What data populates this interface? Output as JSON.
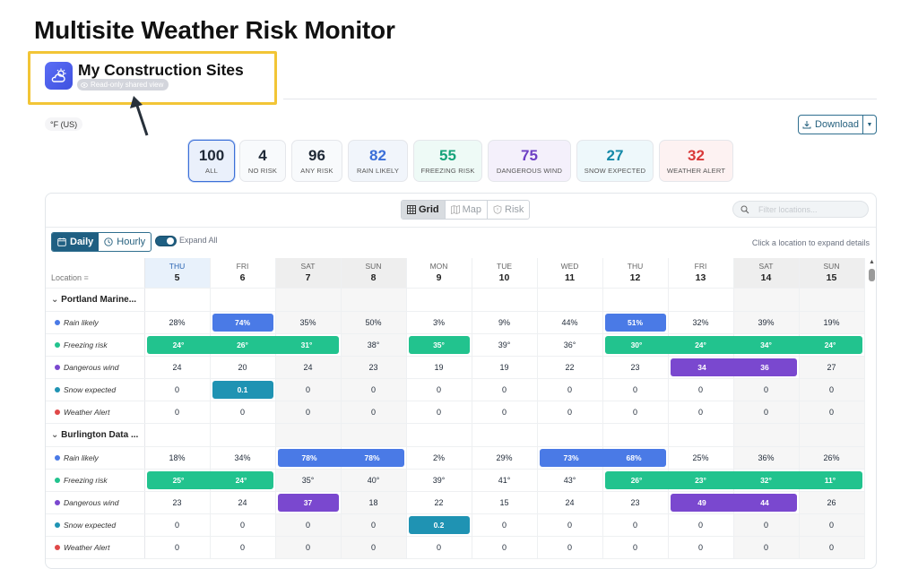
{
  "page_title": "Multisite Weather Risk Monitor",
  "header": {
    "site_title": "My Construction Sites",
    "readonly_label": "Read-only shared view",
    "app_icon": "cloud-sun-icon"
  },
  "unit_label": "°F (US)",
  "download_label": "Download",
  "summary_cards": [
    {
      "value": "100",
      "label": "ALL",
      "color": "#1f2937",
      "selected": true
    },
    {
      "value": "4",
      "label": "NO RISK",
      "color": "#1f2937"
    },
    {
      "value": "96",
      "label": "ANY RISK",
      "color": "#1f2937"
    },
    {
      "value": "82",
      "label": "RAIN LIKELY",
      "color": "#3b6fd8"
    },
    {
      "value": "55",
      "label": "FREEZING RISK",
      "color": "#16a37a"
    },
    {
      "value": "75",
      "label": "DANGEROUS WIND",
      "color": "#6d3fc4"
    },
    {
      "value": "27",
      "label": "SNOW EXPECTED",
      "color": "#1489a8"
    },
    {
      "value": "32",
      "label": "WEATHER ALERT",
      "color": "#d93a3a"
    }
  ],
  "view_tabs": {
    "grid": "Grid",
    "map": "Map",
    "risk": "Risk"
  },
  "filter_placeholder": "Filter locations...",
  "modes": {
    "daily": "Daily",
    "hourly": "Hourly"
  },
  "expand_all_label": "Expand All",
  "hint": "Click a location to expand details",
  "location_header": "Location",
  "days": [
    {
      "dow": "THU",
      "day": "5"
    },
    {
      "dow": "FRI",
      "day": "6"
    },
    {
      "dow": "SAT",
      "day": "7"
    },
    {
      "dow": "SUN",
      "day": "8"
    },
    {
      "dow": "MON",
      "day": "9"
    },
    {
      "dow": "TUE",
      "day": "10"
    },
    {
      "dow": "WED",
      "day": "11"
    },
    {
      "dow": "THU",
      "day": "12"
    },
    {
      "dow": "FRI",
      "day": "13"
    },
    {
      "dow": "SAT",
      "day": "14"
    },
    {
      "dow": "SUN",
      "day": "15"
    }
  ],
  "risk_colors": {
    "rain": "#4a7ae6",
    "freeze": "#22c38e",
    "wind": "#7a48cf",
    "snow": "#1f93b3",
    "alert": "#e04848"
  },
  "locations": [
    {
      "name": "Portland Marine...",
      "rows": [
        {
          "label": "Rain likely",
          "risk": "rain",
          "values": [
            "28%",
            "74%",
            "35%",
            "50%",
            "3%",
            "9%",
            "44%",
            "51%",
            "32%",
            "39%",
            "19%"
          ],
          "flags": [
            0,
            1,
            0,
            0,
            0,
            0,
            0,
            1,
            0,
            0,
            0
          ]
        },
        {
          "label": "Freezing risk",
          "risk": "freeze",
          "values": [
            "24°",
            "26°",
            "31°",
            "38°",
            "35°",
            "39°",
            "36°",
            "30°",
            "24°",
            "34°",
            "24°"
          ],
          "flags": [
            1,
            1,
            1,
            0,
            1,
            0,
            0,
            1,
            1,
            1,
            1
          ]
        },
        {
          "label": "Dangerous wind",
          "risk": "wind",
          "values": [
            "24",
            "20",
            "24",
            "23",
            "19",
            "19",
            "22",
            "23",
            "34",
            "36",
            "27"
          ],
          "flags": [
            0,
            0,
            0,
            0,
            0,
            0,
            0,
            0,
            1,
            1,
            0
          ]
        },
        {
          "label": "Snow expected",
          "risk": "snow",
          "values": [
            "0",
            "0.1",
            "0",
            "0",
            "0",
            "0",
            "0",
            "0",
            "0",
            "0",
            "0"
          ],
          "flags": [
            0,
            1,
            0,
            0,
            0,
            0,
            0,
            0,
            0,
            0,
            0
          ]
        },
        {
          "label": "Weather Alert",
          "risk": "alert",
          "values": [
            "0",
            "0",
            "0",
            "0",
            "0",
            "0",
            "0",
            "0",
            "0",
            "0",
            "0"
          ],
          "flags": [
            0,
            0,
            0,
            0,
            0,
            0,
            0,
            0,
            0,
            0,
            0
          ]
        }
      ]
    },
    {
      "name": "Burlington Data ...",
      "rows": [
        {
          "label": "Rain likely",
          "risk": "rain",
          "values": [
            "18%",
            "34%",
            "78%",
            "78%",
            "2%",
            "29%",
            "73%",
            "68%",
            "25%",
            "36%",
            "26%"
          ],
          "flags": [
            0,
            0,
            1,
            1,
            0,
            0,
            1,
            1,
            0,
            0,
            0
          ]
        },
        {
          "label": "Freezing risk",
          "risk": "freeze",
          "values": [
            "25°",
            "24°",
            "35°",
            "40°",
            "39°",
            "41°",
            "43°",
            "26°",
            "23°",
            "32°",
            "11°"
          ],
          "flags": [
            1,
            1,
            0,
            0,
            0,
            0,
            0,
            1,
            1,
            1,
            1
          ]
        },
        {
          "label": "Dangerous wind",
          "risk": "wind",
          "values": [
            "23",
            "24",
            "37",
            "18",
            "22",
            "15",
            "24",
            "23",
            "49",
            "44",
            "26"
          ],
          "flags": [
            0,
            0,
            1,
            0,
            0,
            0,
            0,
            0,
            1,
            1,
            0
          ]
        },
        {
          "label": "Snow expected",
          "risk": "snow",
          "values": [
            "0",
            "0",
            "0",
            "0",
            "0.2",
            "0",
            "0",
            "0",
            "0",
            "0",
            "0"
          ],
          "flags": [
            0,
            0,
            0,
            0,
            1,
            0,
            0,
            0,
            0,
            0,
            0
          ]
        },
        {
          "label": "Weather Alert",
          "risk": "alert",
          "values": [
            "0",
            "0",
            "0",
            "0",
            "0",
            "0",
            "0",
            "0",
            "0",
            "0",
            "0"
          ],
          "flags": [
            0,
            0,
            0,
            0,
            0,
            0,
            0,
            0,
            0,
            0,
            0
          ]
        }
      ]
    }
  ]
}
